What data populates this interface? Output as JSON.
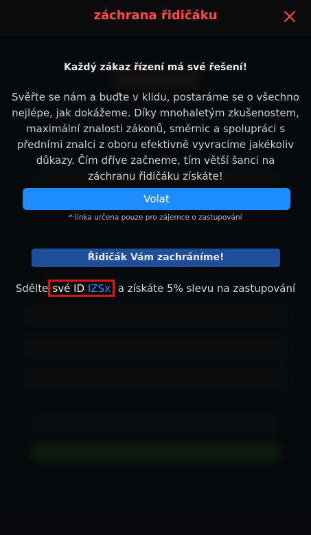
{
  "header": {
    "title": "záchrana řidičáku"
  },
  "modal": {
    "headline": "Každý zákaz řízení má své řešení!",
    "body": "Svěřte se nám a buďte v klidu, postaráme se o všechno nejlépe, jak dokážeme. Díky mnohaletým zkušenostem, maximální znalosti zákonů, směrnic a spolupráci s předními znalci z oboru efektivně vyvracíme jakékoliv důkazy. Čím dříve začneme, tím větší šanci na záchranu řidičáku získáte!",
    "call_label": "Volat",
    "note": "* linka určena pouze pro zájemce o zastupování",
    "save_label": "Řidičák Vám zachráníme!",
    "promo_prefix": "Sdělte",
    "promo_id_text": "své ID",
    "promo_id_code": "IZSx",
    "promo_suffix": "a získáte 5% slevu na zastupování"
  },
  "colors": {
    "accent_red": "#ff4a4a",
    "call_blue": "#1e8bff",
    "highlight_border": "#d51a1a"
  },
  "icons": {
    "close": "close-icon"
  }
}
